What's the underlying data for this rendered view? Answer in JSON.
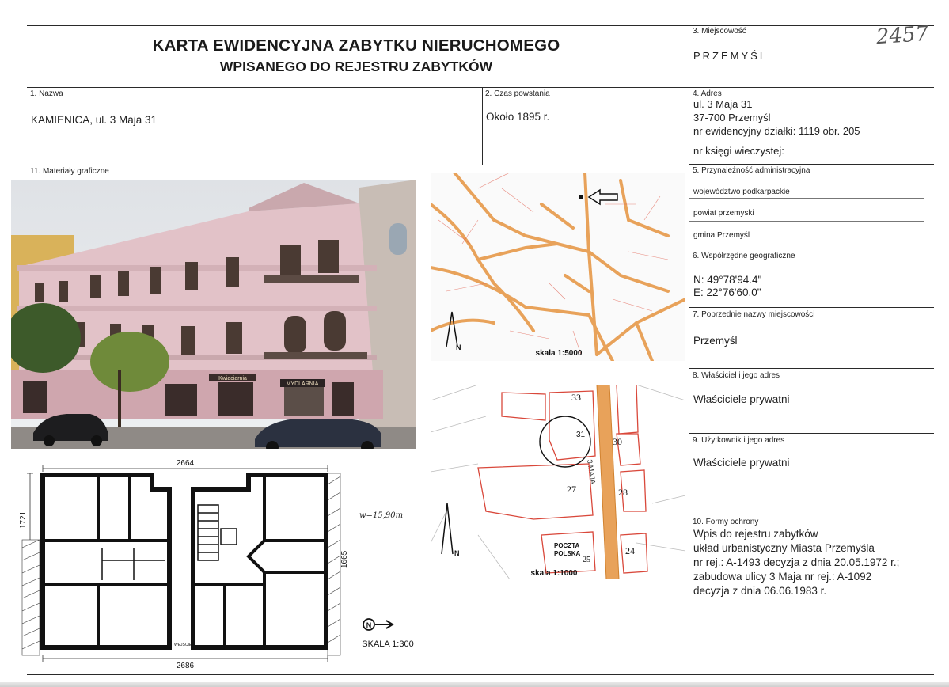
{
  "header": {
    "title_line1": "KARTA EWIDENCYJNA ZABYTKU NIERUCHOMEGO",
    "title_line2": "WPISANEGO DO REJESTRU ZABYTKÓW",
    "handwritten_number": "2457"
  },
  "field3": {
    "label": "3. Miejscowość",
    "value": "PRZEMYŚL"
  },
  "field1": {
    "label": "1. Nazwa",
    "value": "KAMIENICA, ul. 3 Maja 31"
  },
  "field2": {
    "label": "2. Czas powstania",
    "value": "Około 1895 r."
  },
  "field4": {
    "label": "4. Adres",
    "line1": "ul. 3 Maja 31",
    "line2": "37-700 Przemyśl",
    "line3": "nr ewidencyjny działki: 1119 obr. 205",
    "line4": "nr księgi wieczystej:"
  },
  "field11": {
    "label": "11. Materiały graficzne"
  },
  "field5": {
    "label": "5. Przynależność administracyjna",
    "line1": "województwo  podkarpackie",
    "line2": "powiat  przemyski",
    "line3": "gmina  Przemyśl"
  },
  "field6": {
    "label": "6. Współrzędne geograficzne",
    "n": "N: 49°78'94.4\"",
    "e": "E: 22°76'60.0\""
  },
  "field7": {
    "label": "7. Poprzednie nazwy miejscowości",
    "value": "Przemyśl"
  },
  "field8": {
    "label": "8. Właściciel i jego adres",
    "value": "Właściciele prywatni"
  },
  "field9": {
    "label": "9. Użytkownik i jego adres",
    "value": "Właściciele prywatni"
  },
  "field10": {
    "label": "10. Formy ochrony",
    "line1": "Wpis do rejestru zabytków",
    "line2": "układ urbanistyczny Miasta Przemyśla",
    "line3": "nr rej.: A-1493 decyzja z dnia 20.05.1972 r.;",
    "line4": "zabudowa ulicy 3 Maja nr rej.: A-1092",
    "line5": "decyzja z dnia 06.06.1983 r."
  },
  "map1": {
    "scale": "skala 1:5000",
    "north": "N"
  },
  "map2": {
    "scale": "skala 1:1000",
    "north": "N",
    "street": "3 MAJA",
    "numbers": [
      "33",
      "31",
      "30",
      "27",
      "28",
      "24",
      "25"
    ],
    "post_office": [
      "POCZTA",
      "POLSKA"
    ]
  },
  "plan": {
    "dim_top": "2664",
    "dim_bottom": "2686",
    "dim_left": "1721",
    "dim_right": "1665",
    "area_note": "w=15,90m",
    "scale": "SKALA 1:300",
    "entrance": "WEJŚCIE",
    "north": "N"
  },
  "photo": {
    "sign1": "Kwiaciarnia",
    "sign2": "MYDLARNIA"
  },
  "colors": {
    "street_orange": "#e8a25a",
    "parcel_red": "#d9483b",
    "facade_pink": "#e2c2c8"
  }
}
